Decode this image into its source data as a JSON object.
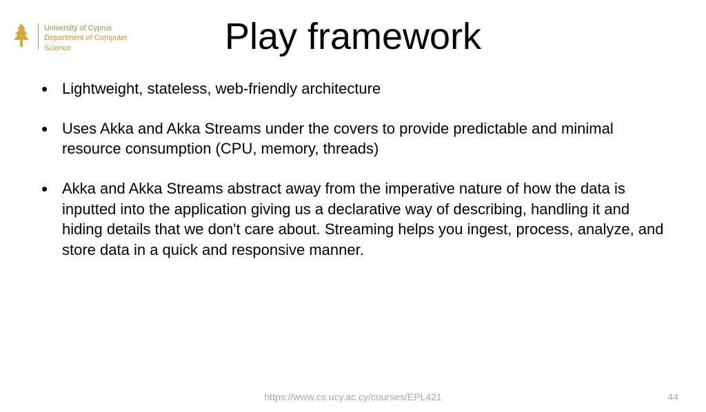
{
  "logo": {
    "line1": "University of Cyprus",
    "line2": "Department of Computer",
    "line3": "Science"
  },
  "title": "Play framework",
  "bullets": [
    "Lightweight, stateless, web-friendly architecture",
    "Uses Akka and Akka Streams under the covers to provide predictable and minimal resource consumption (CPU, memory, threads)",
    "Akka and Akka Streams abstract away from the imperative nature of how the data is inputted into the application giving us a declarative way of describing, handling it and hiding details that we don't care about. Streaming helps you ingest, process, analyze, and store data in a quick and responsive manner."
  ],
  "footer": {
    "url": "https://www.cs.ucy.ac.cy/courses/EPL421",
    "page": "44"
  }
}
